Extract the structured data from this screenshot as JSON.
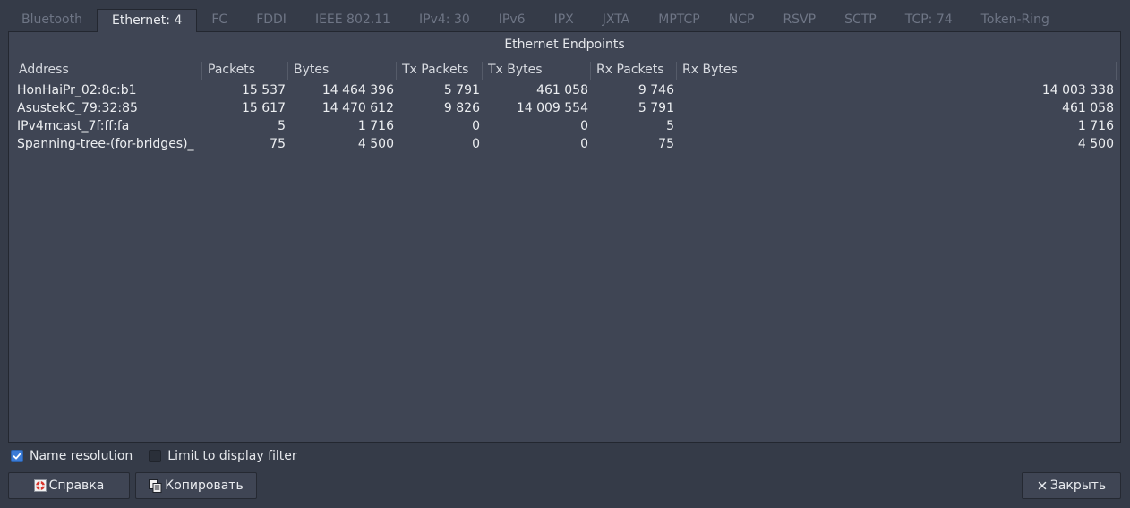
{
  "tabs": [
    {
      "label": "Bluetooth",
      "active": false
    },
    {
      "label": "Ethernet: 4",
      "active": true
    },
    {
      "label": "FC",
      "active": false
    },
    {
      "label": "FDDI",
      "active": false
    },
    {
      "label": "IEEE 802.11",
      "active": false
    },
    {
      "label": "IPv4: 30",
      "active": false
    },
    {
      "label": "IPv6",
      "active": false
    },
    {
      "label": "IPX",
      "active": false
    },
    {
      "label": "JXTA",
      "active": false
    },
    {
      "label": "MPTCP",
      "active": false
    },
    {
      "label": "NCP",
      "active": false
    },
    {
      "label": "RSVP",
      "active": false
    },
    {
      "label": "SCTP",
      "active": false
    },
    {
      "label": "TCP: 74",
      "active": false
    },
    {
      "label": "Token-Ring",
      "active": false
    }
  ],
  "panel": {
    "title": "Ethernet Endpoints"
  },
  "table": {
    "columns": [
      "Address",
      "Packets",
      "Bytes",
      "Tx Packets",
      "Tx Bytes",
      "Rx Packets",
      "Rx Bytes"
    ],
    "rows": [
      [
        "HonHaiPr_02:8c:b1",
        "15 537",
        "14 464 396",
        "5 791",
        "461 058",
        "9 746",
        "14 003 338"
      ],
      [
        "AsustekC_79:32:85",
        "15 617",
        "14 470 612",
        "9 826",
        "14 009 554",
        "5 791",
        "461 058"
      ],
      [
        "IPv4mcast_7f:ff:fa",
        "5",
        "1 716",
        "0",
        "0",
        "5",
        "1 716"
      ],
      [
        "Spanning-tree-(for-bridges)_",
        "75",
        "4 500",
        "0",
        "0",
        "75",
        "4 500"
      ]
    ]
  },
  "options": {
    "name_resolution": {
      "label": "Name resolution",
      "checked": true
    },
    "limit_filter": {
      "label": "Limit to display filter",
      "checked": false
    }
  },
  "buttons": {
    "help": "Справка",
    "copy": "Копировать",
    "close": "Закрыть"
  },
  "colors": {
    "background": "#353b48",
    "panel": "#3f4554",
    "accent_checkbox": "#3b7bd6",
    "inactive_tab_text": "#6e7585"
  },
  "icons": {
    "help": "help-lifebuoy-icon",
    "copy": "copy-icon",
    "close": "close-x-icon"
  }
}
